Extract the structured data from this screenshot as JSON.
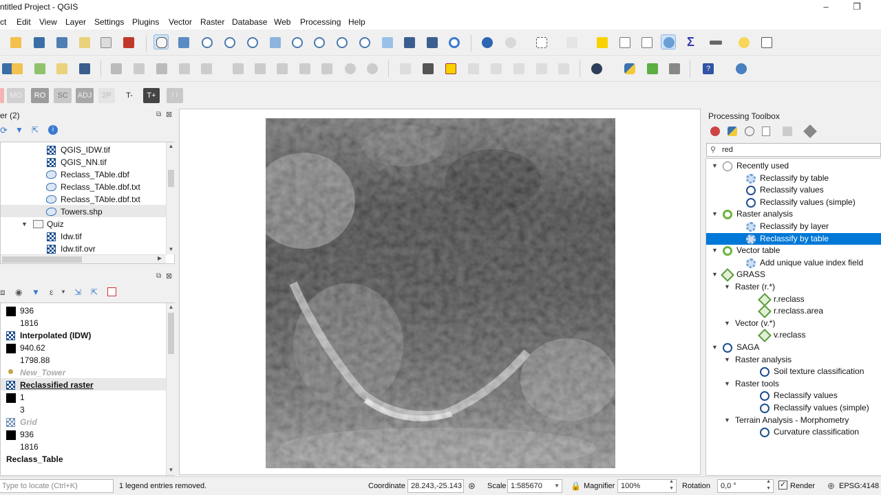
{
  "title_bar": {
    "title": "ntitled Project - QGIS",
    "minimize": "–",
    "restore": "❐"
  },
  "menu": [
    "ct",
    "Edit",
    "View",
    "Layer",
    "Settings",
    "Plugins",
    "Vector",
    "Raster",
    "Database",
    "Web",
    "Processing",
    "Help"
  ],
  "chip_toolbar": [
    "MO",
    "RO",
    "SC",
    "ADJ",
    "2P",
    "T-",
    "T+",
    "! !"
  ],
  "browser_panel": {
    "title": "er (2)",
    "items": [
      {
        "label": "QGIS_IDW.tif",
        "kind": "raster"
      },
      {
        "label": "QGIS_NN.tif",
        "kind": "raster"
      },
      {
        "label": "Reclass_TAble.dbf",
        "kind": "vector"
      },
      {
        "label": "Reclass_TAble.dbf.txt",
        "kind": "vector"
      },
      {
        "label": "Reclass_TAble.dbf.txt",
        "kind": "vector"
      },
      {
        "label": "Towers.shp",
        "kind": "vector"
      },
      {
        "label": "Quiz",
        "kind": "folder"
      },
      {
        "label": "Idw.tif",
        "kind": "raster"
      },
      {
        "label": "Idw.tif.ovr",
        "kind": "raster"
      }
    ]
  },
  "layers_panel": {
    "rows": [
      {
        "label": "936",
        "type": "swatch"
      },
      {
        "label": "1816",
        "type": "swatch-text"
      },
      {
        "label": "Interpolated (IDW)",
        "type": "layer-bold"
      },
      {
        "label": "940.62",
        "type": "swatch"
      },
      {
        "label": "1798.88",
        "type": "swatch-text"
      },
      {
        "label": "New_Tower",
        "type": "layer-italic"
      },
      {
        "label": "Reclassified raster",
        "type": "layer-bold-underline"
      },
      {
        "label": "1",
        "type": "swatch"
      },
      {
        "label": "3",
        "type": "swatch-text"
      },
      {
        "label": "Grid",
        "type": "layer-italic"
      },
      {
        "label": "936",
        "type": "swatch"
      },
      {
        "label": "1816",
        "type": "swatch-text"
      },
      {
        "label": "Reclass_Table",
        "type": "layer-bold-plain"
      }
    ]
  },
  "toolbox": {
    "title": "Processing Toolbox",
    "search_value": "red",
    "tree": [
      {
        "label": "Recently used",
        "level": 0,
        "icon": "clock",
        "expanded": true
      },
      {
        "label": "Reclassify by table",
        "level": 1,
        "icon": "gear"
      },
      {
        "label": "Reclassify values",
        "level": 1,
        "icon": "saga"
      },
      {
        "label": "Reclassify values (simple)",
        "level": 1,
        "icon": "saga"
      },
      {
        "label": "Raster analysis",
        "level": 0,
        "icon": "qgis",
        "expanded": true
      },
      {
        "label": "Reclassify by layer",
        "level": 1,
        "icon": "gear"
      },
      {
        "label": "Reclassify by table",
        "level": 1,
        "icon": "gear",
        "selected": true
      },
      {
        "label": "Vector table",
        "level": 0,
        "icon": "qgis",
        "expanded": true
      },
      {
        "label": "Add unique value index field",
        "level": 1,
        "icon": "gear"
      },
      {
        "label": "GRASS",
        "level": 0,
        "icon": "grass",
        "expanded": true
      },
      {
        "label": "Raster (r.*)",
        "level": 1,
        "icon": "none",
        "expanded": true
      },
      {
        "label": "r.reclass",
        "level": 2,
        "icon": "grass"
      },
      {
        "label": "r.reclass.area",
        "level": 2,
        "icon": "grass"
      },
      {
        "label": "Vector (v.*)",
        "level": 1,
        "icon": "none",
        "expanded": true
      },
      {
        "label": "v.reclass",
        "level": 2,
        "icon": "grass"
      },
      {
        "label": "SAGA",
        "level": 0,
        "icon": "saga",
        "expanded": true
      },
      {
        "label": "Raster analysis",
        "level": 1,
        "icon": "none",
        "expanded": true
      },
      {
        "label": "Soil texture classification",
        "level": 2,
        "icon": "saga"
      },
      {
        "label": "Raster tools",
        "level": 1,
        "icon": "none",
        "expanded": true
      },
      {
        "label": "Reclassify values",
        "level": 2,
        "icon": "saga"
      },
      {
        "label": "Reclassify values (simple)",
        "level": 2,
        "icon": "saga"
      },
      {
        "label": "Terrain Analysis - Morphometry",
        "level": 1,
        "icon": "none",
        "expanded": true
      },
      {
        "label": "Curvature classification",
        "level": 2,
        "icon": "saga"
      }
    ]
  },
  "status_bar": {
    "locator_placeholder": "Type to locate (Ctrl+K)",
    "message": "1 legend entries removed.",
    "coordinate_label": "Coordinate",
    "coordinate_value": "28.243,-25.143",
    "scale_label": "Scale",
    "scale_value": "1:585670",
    "magnifier_label": "Magnifier",
    "magnifier_value": "100%",
    "rotation_label": "Rotation",
    "rotation_value": "0,0 °",
    "render_label": "Render",
    "crs": "EPSG:4148"
  },
  "colors": {
    "selection": "#0078d7",
    "chip_dark": "#5a5a5a",
    "chip_light": "#c8c8c8"
  }
}
